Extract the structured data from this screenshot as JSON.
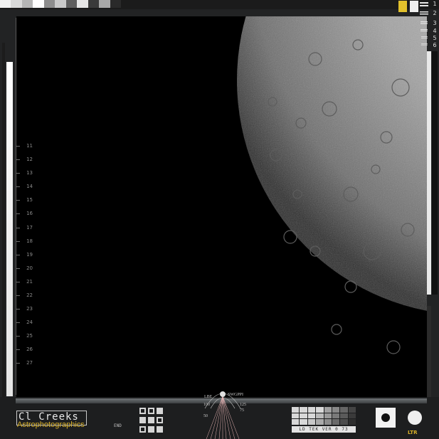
{
  "left_scale": {
    "ticks": [
      "11",
      "12",
      "13",
      "14",
      "15",
      "16",
      "17",
      "18",
      "19",
      "20",
      "21",
      "22",
      "23",
      "24",
      "25",
      "26",
      "27"
    ]
  },
  "right_scale": {
    "numbers": [
      "1",
      "2",
      "3",
      "4",
      "5",
      "6"
    ]
  },
  "logo": {
    "main": "Cl Creeks",
    "sub": "Astrophotographics"
  },
  "gauge": {
    "left_top": "LBE",
    "left_mid": "100",
    "left_low": "50",
    "right_top": "125",
    "right_low": "75",
    "center": "SWGPPI"
  },
  "controls": {
    "end_label": "END"
  },
  "readout": {
    "text": "LD TEK VER  0 73"
  },
  "badge": {
    "ltr": "LTR"
  },
  "colors": {
    "accent": "#d9b12a",
    "frame": "#222324",
    "moon": "#9b9b9b"
  }
}
